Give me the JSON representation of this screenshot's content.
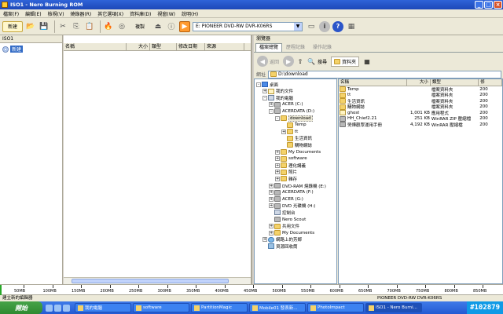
{
  "window": {
    "title": "ISO1 - Nero Burning ROM"
  },
  "menu": [
    "檔案(F)",
    "編輯(E)",
    "檢視(V)",
    "燒錄器(R)",
    "其它選項(X)",
    "資料庫(D)",
    "視窗(W)",
    "說明(H)"
  ],
  "toolbar": {
    "new_label": "新建",
    "erase_label": "複製",
    "drive_name": "E: PIONEER DVD-RW DVR-K06RS"
  },
  "compilation": {
    "caption": "ISO1",
    "root_label": "新建"
  },
  "filelist_columns": [
    "名稱",
    "大小",
    "類型",
    "修改日期",
    "來源"
  ],
  "browser": {
    "caption": "瀏覽器",
    "tabs": [
      "檔案總覽",
      "歷程記錄",
      "操作記錄"
    ],
    "back_label": "返回",
    "search_label": "搜尋",
    "folders_label": "資料夾",
    "address_label": "網址",
    "address_value": "D:\\download",
    "tree": [
      {
        "label": "桌面",
        "level": 0,
        "icon": "desktop",
        "exp": "-"
      },
      {
        "label": "我的文件",
        "level": 1,
        "icon": "doc",
        "exp": "+"
      },
      {
        "label": "我的電腦",
        "level": 1,
        "icon": "pc",
        "exp": "-"
      },
      {
        "label": "ACER (C:)",
        "level": 2,
        "icon": "drive",
        "exp": "+"
      },
      {
        "label": "ACERDATA (D:)",
        "level": 2,
        "icon": "drive",
        "exp": "-"
      },
      {
        "label": "download",
        "level": 3,
        "icon": "folder",
        "exp": "-",
        "sel": true
      },
      {
        "label": "Temp",
        "level": 4,
        "icon": "folder",
        "exp": ""
      },
      {
        "label": "tt",
        "level": 4,
        "icon": "folder",
        "exp": "+"
      },
      {
        "label": "生活資訊",
        "level": 4,
        "icon": "folder",
        "exp": ""
      },
      {
        "label": "購物網誌",
        "level": 4,
        "icon": "folder",
        "exp": ""
      },
      {
        "label": "My Documents",
        "level": 3,
        "icon": "folder",
        "exp": "+"
      },
      {
        "label": "software",
        "level": 3,
        "icon": "folder",
        "exp": "+"
      },
      {
        "label": "理化講義",
        "level": 3,
        "icon": "folder",
        "exp": "+"
      },
      {
        "label": "照片",
        "level": 3,
        "icon": "folder",
        "exp": "+"
      },
      {
        "label": "雜存",
        "level": 3,
        "icon": "folder",
        "exp": "+"
      },
      {
        "label": "DVD-RAM 燒錄機 (E:)",
        "level": 2,
        "icon": "drive",
        "exp": "+"
      },
      {
        "label": "ACERDATA (F:)",
        "level": 2,
        "icon": "drive",
        "exp": "+"
      },
      {
        "label": "ACER (G:)",
        "level": 2,
        "icon": "drive",
        "exp": "+"
      },
      {
        "label": "DVD 光碟機 (H:)",
        "level": 2,
        "icon": "drive",
        "exp": "+"
      },
      {
        "label": "控制台",
        "level": 2,
        "icon": "pc",
        "exp": ""
      },
      {
        "label": "Nero Scout",
        "level": 2,
        "icon": "drive",
        "exp": ""
      },
      {
        "label": "共用文件",
        "level": 2,
        "icon": "folder",
        "exp": "+"
      },
      {
        "label": "My Documents",
        "level": 2,
        "icon": "folder",
        "exp": "+"
      },
      {
        "label": "網路上的芳鄰",
        "level": 1,
        "icon": "net",
        "exp": "+"
      },
      {
        "label": "資源回收筒",
        "level": 1,
        "icon": "bin",
        "exp": ""
      }
    ],
    "file_columns": [
      "名稱",
      "大小",
      "類型",
      "修"
    ],
    "files": [
      {
        "name": "Temp",
        "size": "",
        "type": "檔案資料夾",
        "mod": "200",
        "icon": "folder"
      },
      {
        "name": "tt",
        "size": "",
        "type": "檔案資料夾",
        "mod": "200",
        "icon": "folder"
      },
      {
        "name": "生活資訊",
        "size": "",
        "type": "檔案資料夾",
        "mod": "200",
        "icon": "folder"
      },
      {
        "name": "購物網誌",
        "size": "",
        "type": "檔案資料夾",
        "mod": "200",
        "icon": "folder"
      },
      {
        "name": "ghost",
        "size": "1,001 KB",
        "type": "應用程式",
        "mod": "200",
        "icon": "doc"
      },
      {
        "name": "HH_Chief2.21",
        "size": "251 KB",
        "type": "WinRAR ZIP 壓縮檔",
        "mod": "200",
        "icon": "drive"
      },
      {
        "name": "勞燁觀眾運用手冊",
        "size": "4,192 KB",
        "type": "WinRAR 壓縮檔",
        "mod": "200",
        "icon": "drive"
      }
    ]
  },
  "ruler": [
    "50MB",
    "100MB",
    "150MB",
    "200MB",
    "250MB",
    "300MB",
    "350MB",
    "400MB",
    "450MB",
    "500MB",
    "550MB",
    "600MB",
    "650MB",
    "700MB",
    "750MB",
    "800MB",
    "850MB"
  ],
  "status": {
    "left": "建立新的編輯器",
    "right": "PIONEER  DVD-RW DVR-K06RS"
  },
  "taskbar": {
    "start_label": "開始",
    "tasks": [
      "我的電腦",
      "software",
      "PartitionMagic",
      "Mobile01 發表新...",
      "PhotoImpact",
      "ISO1 - Nero Burni..."
    ],
    "active_index": 5,
    "tray_text": "#102879"
  }
}
